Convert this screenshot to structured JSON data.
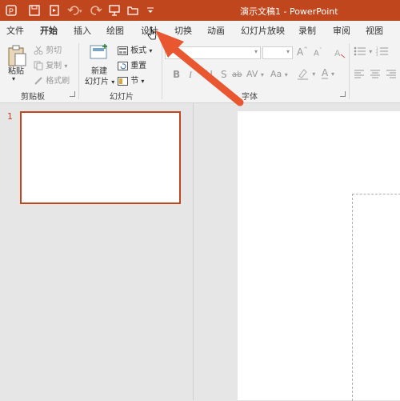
{
  "title": "演示文稿1  -  PowerPoint",
  "qat_icons": [
    "powerpoint-logo-icon",
    "save-icon",
    "present-from-beginning-icon",
    "undo-icon",
    "redo-icon",
    "presentation-icon",
    "open-folder-icon",
    "customize-qat-icon"
  ],
  "tabs": [
    "文件",
    "开始",
    "插入",
    "绘图",
    "设计",
    "切换",
    "动画",
    "幻灯片放映",
    "录制",
    "审阅",
    "视图"
  ],
  "active_tab": "开始",
  "ribbon": {
    "clipboard": {
      "paste": "粘贴",
      "cut": "剪切",
      "copy": "复制",
      "format_painter": "格式刷",
      "label": "剪贴板"
    },
    "slides": {
      "new_slide_line1": "新建",
      "new_slide_line2": "幻灯片",
      "layout": "板式",
      "reset": "重置",
      "section": "节",
      "label": "幻灯片"
    },
    "font": {
      "bold": "B",
      "italic": "I",
      "underline": "U",
      "strikethrough": "S",
      "shadow": "ab",
      "char_spacing": "AV",
      "change_case": "Aa",
      "grow": "A",
      "shrink": "A",
      "font_color": "A",
      "label": "字体"
    }
  },
  "slide_panel": {
    "slide_number": "1"
  },
  "colors": {
    "accent": "#c0461e",
    "arrow": "#e8572f",
    "ribbon_bg": "#f3f3f3",
    "pane_bg": "#e6e6e6"
  }
}
